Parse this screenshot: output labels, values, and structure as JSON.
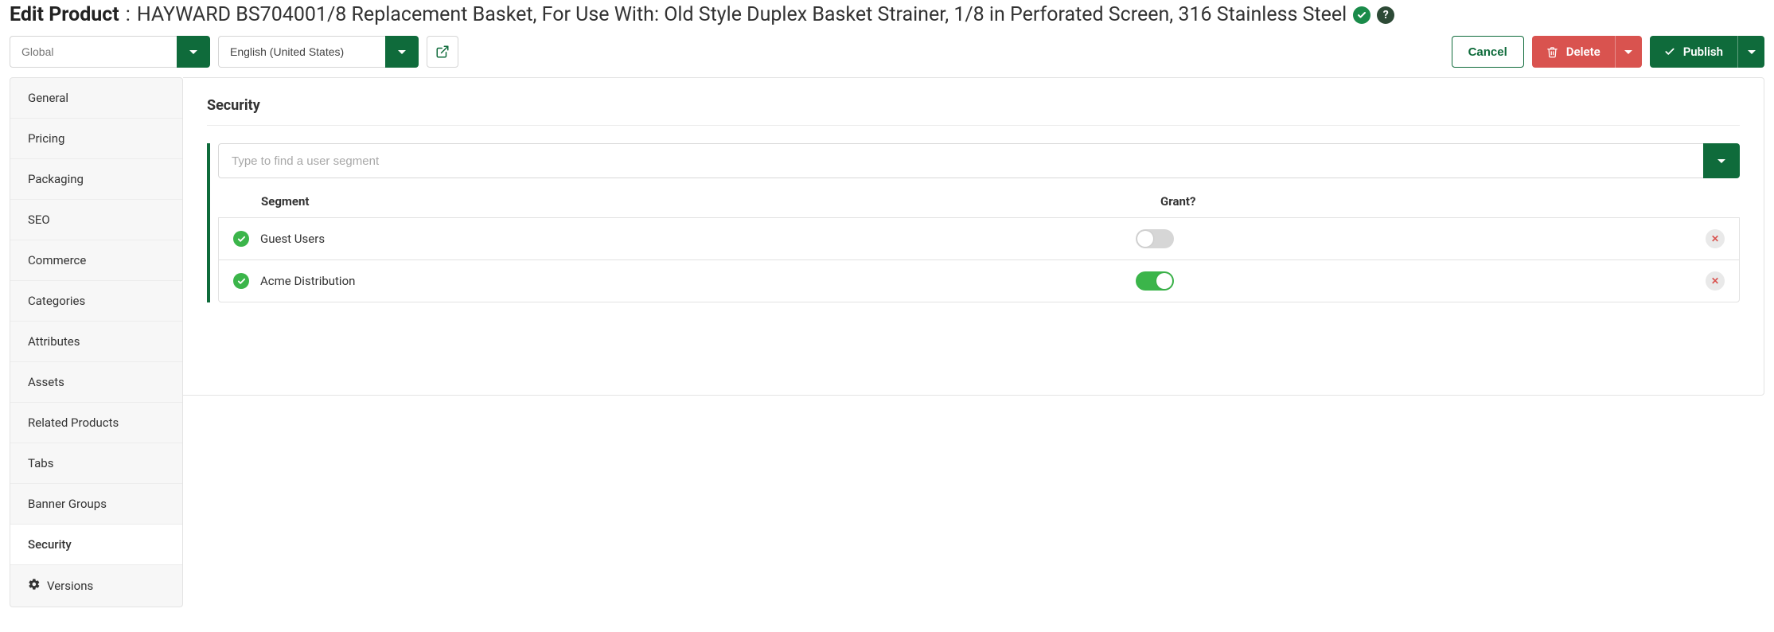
{
  "header": {
    "title_prefix": "Edit Product",
    "title_name": "HAYWARD BS704001/8 Replacement Basket, For Use With: Old Style Duplex Basket Strainer, 1/8 in Perforated Screen, 316 Stainless Steel"
  },
  "toolbar": {
    "scope_placeholder": "Global",
    "locale_value": "English (United States)",
    "cancel_label": "Cancel",
    "delete_label": "Delete",
    "publish_label": "Publish"
  },
  "sidebar": {
    "items": [
      {
        "label": "General"
      },
      {
        "label": "Pricing"
      },
      {
        "label": "Packaging"
      },
      {
        "label": "SEO"
      },
      {
        "label": "Commerce"
      },
      {
        "label": "Categories"
      },
      {
        "label": "Attributes"
      },
      {
        "label": "Assets"
      },
      {
        "label": "Related Products"
      },
      {
        "label": "Tabs"
      },
      {
        "label": "Banner Groups"
      },
      {
        "label": "Security"
      },
      {
        "label": "Versions"
      }
    ],
    "active_index": 11
  },
  "panel": {
    "heading": "Security",
    "segment_search_placeholder": "Type to find a user segment",
    "columns": {
      "segment": "Segment",
      "grant": "Grant?"
    },
    "rows": [
      {
        "name": "Guest Users",
        "granted": false
      },
      {
        "name": "Acme Distribution",
        "granted": true
      }
    ]
  }
}
